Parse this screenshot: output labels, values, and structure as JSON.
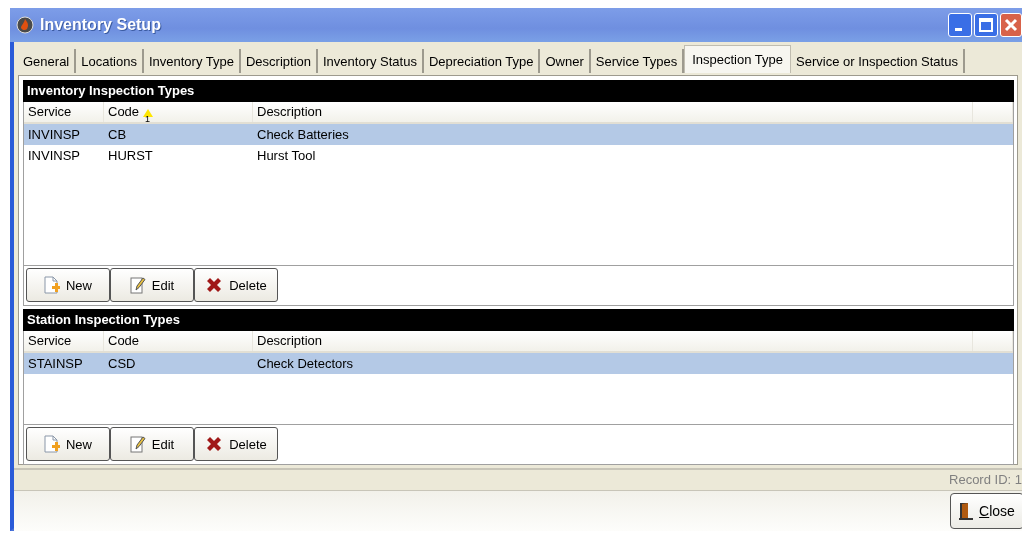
{
  "window": {
    "title": "Inventory Setup"
  },
  "tabs": [
    {
      "label": "General",
      "selected": false
    },
    {
      "label": "Locations",
      "selected": false
    },
    {
      "label": "Inventory Type",
      "selected": false
    },
    {
      "label": "Description",
      "selected": false
    },
    {
      "label": "Inventory Status",
      "selected": false
    },
    {
      "label": "Depreciation Type",
      "selected": false
    },
    {
      "label": "Owner",
      "selected": false
    },
    {
      "label": "Service Types",
      "selected": false
    },
    {
      "label": "Inspection Type",
      "selected": true
    },
    {
      "label": "Service or Inspection Status",
      "selected": false
    }
  ],
  "sections": [
    {
      "title": "Inventory Inspection Types",
      "columns": [
        {
          "label": "Service"
        },
        {
          "label": "Code",
          "sort_order": "1"
        },
        {
          "label": "Description"
        }
      ],
      "rows": [
        {
          "cells": [
            "INVINSP",
            "CB",
            "Check Batteries"
          ],
          "selected": true
        },
        {
          "cells": [
            "INVINSP",
            "HURST",
            "Hurst Tool"
          ],
          "selected": false
        }
      ],
      "buttons": [
        {
          "kind": "new",
          "label": "New"
        },
        {
          "kind": "edit",
          "label": "Edit"
        },
        {
          "kind": "delete",
          "label": "Delete"
        }
      ]
    },
    {
      "title": "Station Inspection Types",
      "columns": [
        {
          "label": "Service"
        },
        {
          "label": "Code"
        },
        {
          "label": "Description"
        }
      ],
      "rows": [
        {
          "cells": [
            "STAINSP",
            "CSD",
            "Check Detectors"
          ],
          "selected": true
        }
      ],
      "buttons": [
        {
          "kind": "new",
          "label": "New"
        },
        {
          "kind": "edit",
          "label": "Edit"
        },
        {
          "kind": "delete",
          "label": "Delete"
        }
      ]
    }
  ],
  "status_bar": {
    "text": "Record ID: 1"
  },
  "footer": {
    "close_button": {
      "label": "Close",
      "first_letter_underlined": true
    }
  }
}
